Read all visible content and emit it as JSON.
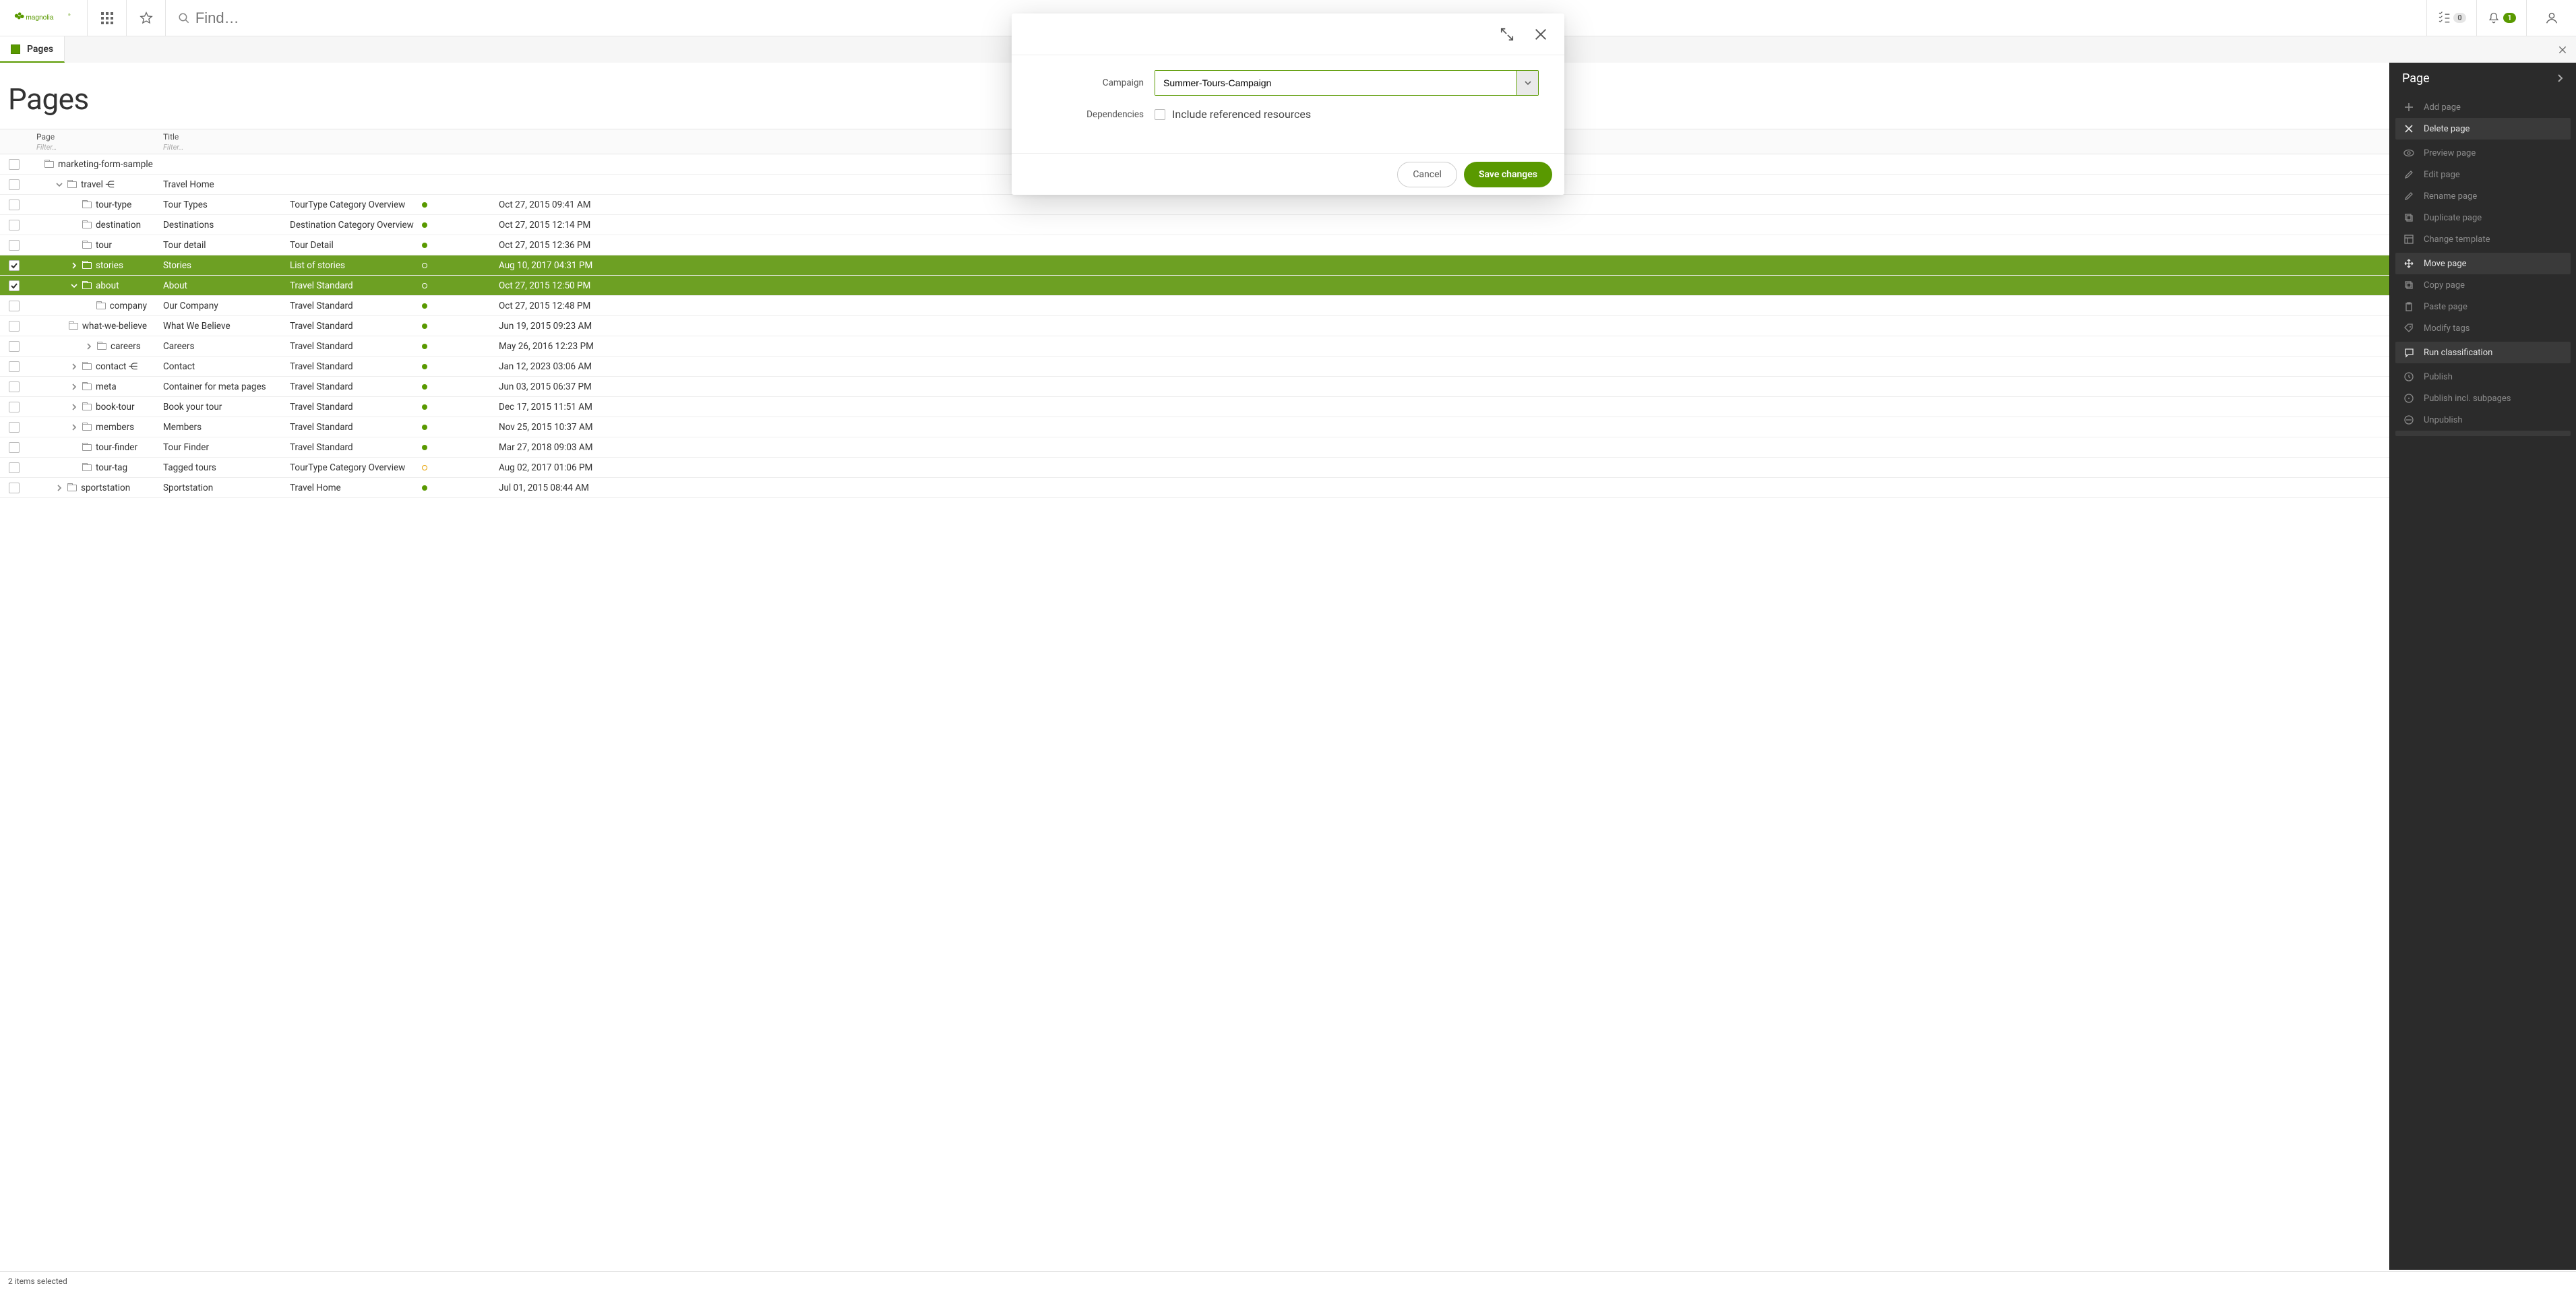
{
  "topbar": {
    "search_placeholder": "Find…",
    "tasks_count": "0",
    "notif_count": "1"
  },
  "approw": {
    "app_label": "Pages"
  },
  "page_title": "Pages",
  "table": {
    "columns": {
      "page": {
        "label": "Page",
        "filter": "Filter…"
      },
      "title": {
        "label": "Title",
        "filter": "Filter…"
      }
    },
    "rows": [
      {
        "indent": 2,
        "expander": "",
        "name": "marketing-form-sample",
        "title": "",
        "template": "",
        "status": "",
        "date": "",
        "selected": false
      },
      {
        "indent": 2,
        "expander": "down",
        "name": "travel ⋲",
        "title": "Travel Home",
        "template": "",
        "status": "",
        "date": "",
        "selected": false
      },
      {
        "indent": 3,
        "expander": "",
        "name": "tour-type",
        "title": "Tour Types",
        "template": "TourType Category Overview",
        "status": "pub",
        "date": "Oct 27, 2015 09:41 AM",
        "selected": false
      },
      {
        "indent": 3,
        "expander": "",
        "name": "destination",
        "title": "Destinations",
        "template": "Destination Category Overview",
        "status": "pub",
        "date": "Oct 27, 2015 12:14 PM",
        "selected": false
      },
      {
        "indent": 3,
        "expander": "",
        "name": "tour",
        "title": "Tour detail",
        "template": "Tour Detail",
        "status": "pub",
        "date": "Oct 27, 2015 12:36 PM",
        "selected": false
      },
      {
        "indent": 3,
        "expander": "right",
        "name": "stories",
        "title": "Stories",
        "template": "List of stories",
        "status": "mod",
        "date": "Aug 10, 2017 04:31 PM",
        "selected": true
      },
      {
        "indent": 3,
        "expander": "down",
        "name": "about",
        "title": "About",
        "template": "Travel Standard",
        "status": "mod",
        "date": "Oct 27, 2015 12:50 PM",
        "selected": true
      },
      {
        "indent": 4,
        "expander": "",
        "name": "company",
        "title": "Our Company",
        "template": "Travel Standard",
        "status": "pub",
        "date": "Oct 27, 2015 12:48 PM",
        "selected": false
      },
      {
        "indent": 4,
        "expander": "",
        "name": "what-we-believe",
        "title": "What We Believe",
        "template": "Travel Standard",
        "status": "pub",
        "date": "Jun 19, 2015 09:23 AM",
        "selected": false
      },
      {
        "indent": 4,
        "expander": "right",
        "name": "careers",
        "title": "Careers",
        "template": "Travel Standard",
        "status": "pub",
        "date": "May 26, 2016 12:23 PM",
        "selected": false
      },
      {
        "indent": 3,
        "expander": "right",
        "name": "contact ⋲",
        "title": "Contact",
        "template": "Travel Standard",
        "status": "pub",
        "date": "Jan 12, 2023 03:06 AM",
        "selected": false
      },
      {
        "indent": 3,
        "expander": "right",
        "name": "meta",
        "title": "Container for meta pages",
        "template": "Travel Standard",
        "status": "pub",
        "date": "Jun 03, 2015 06:37 PM",
        "selected": false
      },
      {
        "indent": 3,
        "expander": "right",
        "name": "book-tour",
        "title": "Book your tour",
        "template": "Travel Standard",
        "status": "pub",
        "date": "Dec 17, 2015 11:51 AM",
        "selected": false
      },
      {
        "indent": 3,
        "expander": "right",
        "name": "members",
        "title": "Members",
        "template": "Travel Standard",
        "status": "pub",
        "date": "Nov 25, 2015 10:37 AM",
        "selected": false
      },
      {
        "indent": 3,
        "expander": "",
        "name": "tour-finder",
        "title": "Tour Finder",
        "template": "Travel Standard",
        "status": "pub",
        "date": "Mar 27, 2018 09:03 AM",
        "selected": false
      },
      {
        "indent": 3,
        "expander": "",
        "name": "tour-tag",
        "title": "Tagged tours",
        "template": "TourType Category Overview",
        "status": "amber",
        "date": "Aug 02, 2017 01:06 PM",
        "selected": false
      },
      {
        "indent": 2,
        "expander": "right",
        "name": "sportstation",
        "title": "Sportstation",
        "template": "Travel Home",
        "status": "pub",
        "date": "Jul 01, 2015 08:44 AM",
        "selected": false
      }
    ]
  },
  "statusbar": "2 items selected",
  "panel": {
    "title": "Page",
    "items": [
      {
        "label": "Add page",
        "enabled": false,
        "icon": "plus"
      },
      {
        "label": "Delete page",
        "enabled": true,
        "icon": "x"
      },
      {
        "sep": true
      },
      {
        "label": "Preview page",
        "enabled": false,
        "icon": "eye"
      },
      {
        "label": "Edit page",
        "enabled": false,
        "icon": "pencil"
      },
      {
        "label": "Rename page",
        "enabled": false,
        "icon": "pencil"
      },
      {
        "label": "Duplicate page",
        "enabled": false,
        "icon": "copy"
      },
      {
        "label": "Change template",
        "enabled": false,
        "icon": "layout"
      },
      {
        "sep": true
      },
      {
        "label": "Move page",
        "enabled": true,
        "icon": "move"
      },
      {
        "label": "Copy page",
        "enabled": false,
        "icon": "copy"
      },
      {
        "label": "Paste page",
        "enabled": false,
        "icon": "paste"
      },
      {
        "label": "Modify tags",
        "enabled": false,
        "icon": "tag"
      },
      {
        "sep": true
      },
      {
        "label": "Run classification",
        "enabled": true,
        "icon": "chat"
      },
      {
        "sep": true
      },
      {
        "label": "Publish",
        "enabled": false,
        "icon": "clock"
      },
      {
        "label": "Publish incl. subpages",
        "enabled": false,
        "icon": "clock2"
      },
      {
        "label": "Unpublish",
        "enabled": false,
        "icon": "unpub"
      }
    ]
  },
  "modal": {
    "campaign_label": "Campaign",
    "campaign_value": "Summer-Tours-Campaign",
    "deps_label": "Dependencies",
    "deps_checkbox_label": "Include referenced resources",
    "cancel": "Cancel",
    "save": "Save changes"
  }
}
